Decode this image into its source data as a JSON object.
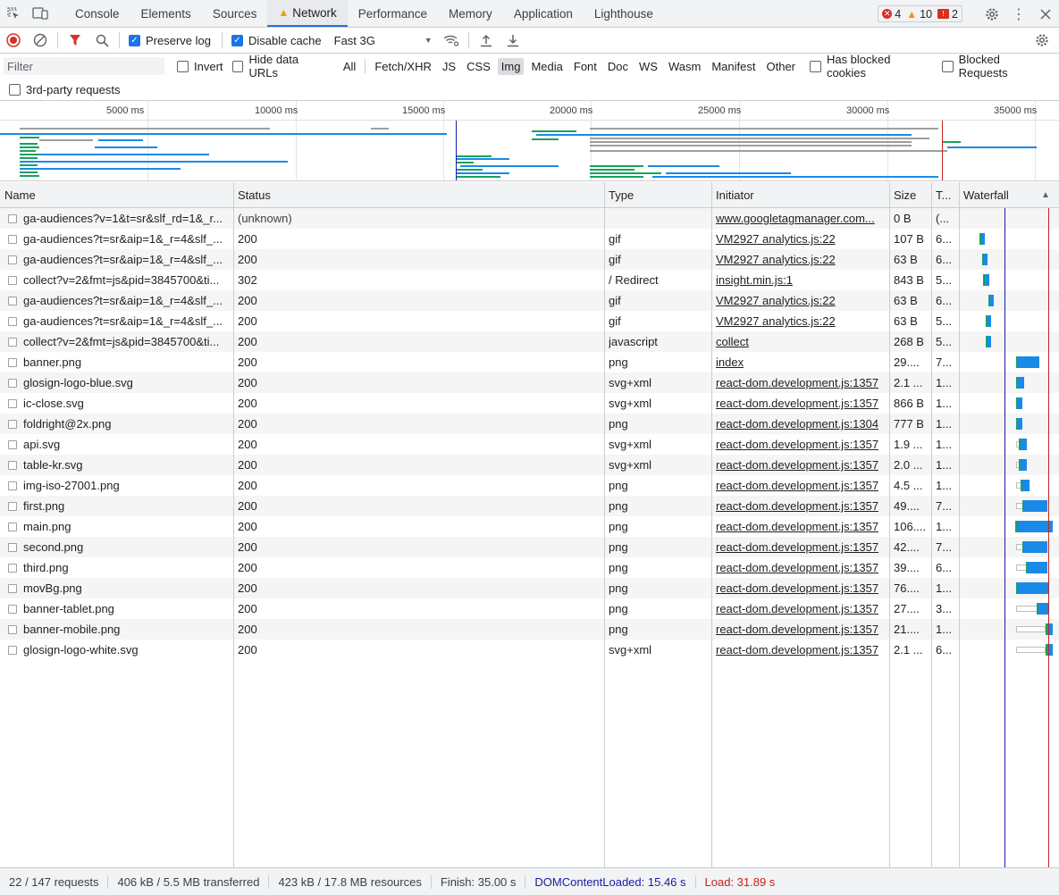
{
  "tabs": [
    {
      "label": "Console",
      "active": false
    },
    {
      "label": "Elements",
      "active": false
    },
    {
      "label": "Sources",
      "active": false
    },
    {
      "label": "Network",
      "active": true
    },
    {
      "label": "Performance",
      "active": false
    },
    {
      "label": "Memory",
      "active": false
    },
    {
      "label": "Application",
      "active": false
    },
    {
      "label": "Lighthouse",
      "active": false
    }
  ],
  "counters": {
    "errors": "4",
    "warnings": "10",
    "issues": "2"
  },
  "toolbar": {
    "preserve_log": "Preserve log",
    "disable_cache": "Disable cache",
    "throttling": "Fast 3G"
  },
  "filter": {
    "placeholder": "Filter",
    "invert": "Invert",
    "hide_data_urls": "Hide data URLs",
    "types": [
      "All",
      "Fetch/XHR",
      "JS",
      "CSS",
      "Img",
      "Media",
      "Font",
      "Doc",
      "WS",
      "Wasm",
      "Manifest",
      "Other"
    ],
    "active_type": "Img",
    "has_blocked_cookies": "Has blocked cookies",
    "blocked_requests": "Blocked Requests",
    "third_party": "3rd-party requests"
  },
  "overview": {
    "ticks": [
      "5000 ms",
      "10000 ms",
      "15000 ms",
      "20000 ms",
      "25000 ms",
      "30000 ms",
      "35000 ms"
    ]
  },
  "columns": {
    "name": "Name",
    "status": "Status",
    "type": "Type",
    "initiator": "Initiator",
    "size": "Size",
    "time": "T...",
    "waterfall": "Waterfall"
  },
  "rows": [
    {
      "name": "ga-audiences?v=1&t=sr&slf_rd=1&_r...",
      "status": "(unknown)",
      "type": "",
      "initiator": "www.googletagmanager.com...",
      "size": "0 B",
      "time": "(..."
    },
    {
      "name": "ga-audiences?t=sr&aip=1&_r=4&slf_...",
      "status": "200",
      "type": "gif",
      "initiator": "VM2927 analytics.js:22",
      "size": "107 B",
      "time": "6..."
    },
    {
      "name": "ga-audiences?t=sr&aip=1&_r=4&slf_...",
      "status": "200",
      "type": "gif",
      "initiator": "VM2927 analytics.js:22",
      "size": "63 B",
      "time": "6..."
    },
    {
      "name": "collect?v=2&fmt=js&pid=3845700&ti...",
      "status": "302",
      "type": "/ Redirect",
      "initiator": "insight.min.js:1",
      "size": "843 B",
      "time": "5..."
    },
    {
      "name": "ga-audiences?t=sr&aip=1&_r=4&slf_...",
      "status": "200",
      "type": "gif",
      "initiator": "VM2927 analytics.js:22",
      "size": "63 B",
      "time": "6..."
    },
    {
      "name": "ga-audiences?t=sr&aip=1&_r=4&slf_...",
      "status": "200",
      "type": "gif",
      "initiator": "VM2927 analytics.js:22",
      "size": "63 B",
      "time": "5..."
    },
    {
      "name": "collect?v=2&fmt=js&pid=3845700&ti...",
      "status": "200",
      "type": "javascript",
      "initiator": "collect",
      "size": "268 B",
      "time": "5..."
    },
    {
      "name": "banner.png",
      "status": "200",
      "type": "png",
      "initiator": "index",
      "size": "29....",
      "time": "7..."
    },
    {
      "name": "glosign-logo-blue.svg",
      "status": "200",
      "type": "svg+xml",
      "initiator": "react-dom.development.js:1357",
      "size": "2.1 ...",
      "time": "1..."
    },
    {
      "name": "ic-close.svg",
      "status": "200",
      "type": "svg+xml",
      "initiator": "react-dom.development.js:1357",
      "size": "866 B",
      "time": "1..."
    },
    {
      "name": "foldright@2x.png",
      "status": "200",
      "type": "png",
      "initiator": "react-dom.development.js:1304",
      "size": "777 B",
      "time": "1..."
    },
    {
      "name": "api.svg",
      "status": "200",
      "type": "svg+xml",
      "initiator": "react-dom.development.js:1357",
      "size": "1.9 ...",
      "time": "1..."
    },
    {
      "name": "table-kr.svg",
      "status": "200",
      "type": "svg+xml",
      "initiator": "react-dom.development.js:1357",
      "size": "2.0 ...",
      "time": "1..."
    },
    {
      "name": "img-iso-27001.png",
      "status": "200",
      "type": "png",
      "initiator": "react-dom.development.js:1357",
      "size": "4.5 ...",
      "time": "1..."
    },
    {
      "name": "first.png",
      "status": "200",
      "type": "png",
      "initiator": "react-dom.development.js:1357",
      "size": "49....",
      "time": "7..."
    },
    {
      "name": "main.png",
      "status": "200",
      "type": "png",
      "initiator": "react-dom.development.js:1357",
      "size": "106....",
      "time": "1..."
    },
    {
      "name": "second.png",
      "status": "200",
      "type": "png",
      "initiator": "react-dom.development.js:1357",
      "size": "42....",
      "time": "7..."
    },
    {
      "name": "third.png",
      "status": "200",
      "type": "png",
      "initiator": "react-dom.development.js:1357",
      "size": "39....",
      "time": "6..."
    },
    {
      "name": "movBg.png",
      "status": "200",
      "type": "png",
      "initiator": "react-dom.development.js:1357",
      "size": "76....",
      "time": "1..."
    },
    {
      "name": "banner-tablet.png",
      "status": "200",
      "type": "png",
      "initiator": "react-dom.development.js:1357",
      "size": "27....",
      "time": "3..."
    },
    {
      "name": "banner-mobile.png",
      "status": "200",
      "type": "png",
      "initiator": "react-dom.development.js:1357",
      "size": "21....",
      "time": "1..."
    },
    {
      "name": "glosign-logo-white.svg",
      "status": "200",
      "type": "svg+xml",
      "initiator": "react-dom.development.js:1357",
      "size": "2.1 ...",
      "time": "6..."
    }
  ],
  "statusbar": {
    "requests": "22 / 147 requests",
    "transferred": "406 kB / 5.5 MB transferred",
    "resources": "423 kB / 17.8 MB resources",
    "finish": "Finish: 35.00 s",
    "dom": "DOMContentLoaded: 15.46 s",
    "load": "Load: 31.89 s"
  },
  "colors": {
    "accent": "#1a73e8",
    "error": "#d93025",
    "warning": "#f29900",
    "dom_line": "#1a1aa6",
    "load_line": "#c5221f",
    "waterfall_blue": "#1a8ae8",
    "waterfall_green": "#1aa15f",
    "waterfall_gray": "#9e9e9e"
  }
}
